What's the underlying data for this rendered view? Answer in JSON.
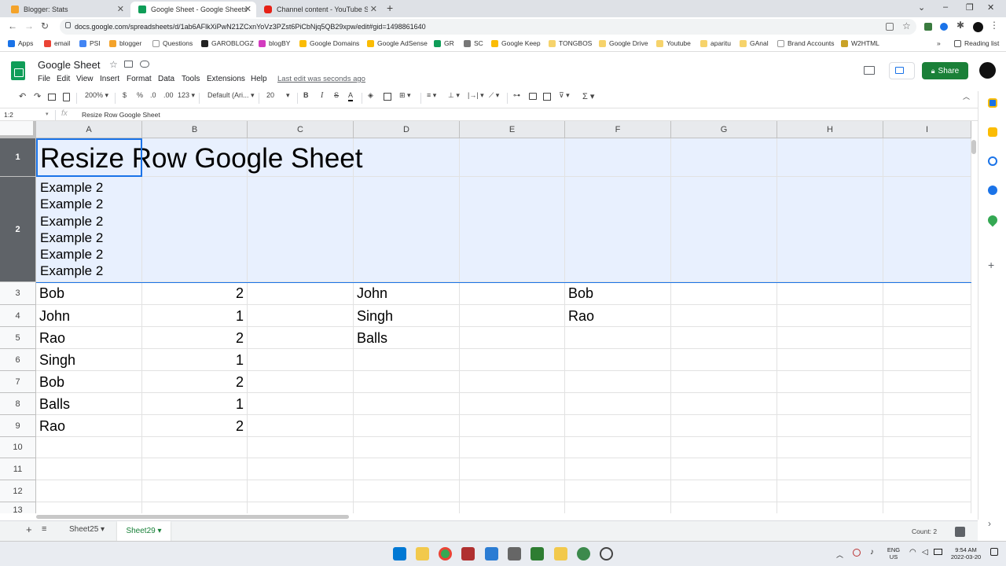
{
  "browser": {
    "tabs": [
      {
        "title": "Blogger: Stats",
        "fav_color": "#f4a32a"
      },
      {
        "title": "Google Sheet - Google Sheets",
        "fav_color": "#0f9d58"
      },
      {
        "title": "Channel content - YouTube Studio",
        "fav_color": "#e62117"
      }
    ],
    "url": "docs.google.com/spreadsheets/d/1ab6AFlkXiPwN21ZCxnYoVz3PZst6PiCbNjq5QB29xpw/edit#gid=1498861640",
    "bookmarks": [
      "Apps",
      "email",
      "PSI",
      "blogger",
      "Questions",
      "GAROBLOGZ",
      "blogBY",
      "Google Domains",
      "Google AdSense",
      "GR",
      "SC",
      "Google Keep",
      "TONGBOS",
      "Google Drive",
      "Youtube",
      "aparitu",
      "GAnal",
      "Brand Accounts",
      "W2HTML"
    ],
    "reading_list": "Reading list"
  },
  "sheets": {
    "doc_title": "Google Sheet",
    "menu": [
      "File",
      "Edit",
      "View",
      "Insert",
      "Format",
      "Data",
      "Tools",
      "Extensions",
      "Help"
    ],
    "last_edit": "Last edit was seconds ago",
    "share_label": "Share",
    "toolbar": {
      "zoom": "200%",
      "currency": "$",
      "percent": "%",
      "dec_dec": ".0",
      "dec_inc": ".00",
      "format": "123",
      "font": "Default (Ari...",
      "font_size": "20",
      "bold": "B",
      "italic": "I",
      "strike": "S",
      "text_color": "A"
    },
    "name_box": "1:2",
    "formula": "Resize Row Google Sheet"
  },
  "grid": {
    "columns": [
      "A",
      "B",
      "C",
      "D",
      "E",
      "F",
      "G",
      "H",
      "I"
    ],
    "rows": [
      "1",
      "2",
      "3",
      "4",
      "5",
      "6",
      "7",
      "8",
      "9",
      "10",
      "11",
      "12",
      "13"
    ],
    "title_cell": "Resize Row Google Sheet",
    "row2_lines": [
      "Example 2",
      "Example 2",
      "Example 2",
      "Example 2",
      "Example 2",
      "Example 2"
    ],
    "col_a": [
      "Bob",
      "John",
      "Rao",
      "Singh",
      "Bob",
      "Balls",
      "Rao"
    ],
    "col_b": [
      "2",
      "1",
      "2",
      "1",
      "2",
      "1",
      "2"
    ],
    "col_d": [
      "John",
      "Singh",
      "Balls"
    ],
    "col_f": [
      "Bob",
      "Rao"
    ]
  },
  "sheet_tabs": {
    "tabs": [
      "Sheet25",
      "Sheet29"
    ],
    "active": "Sheet29",
    "count": "Count: 2"
  },
  "taskbar": {
    "lang": "ENG",
    "region": "US",
    "time": "9:54 AM",
    "date": "2022-03-20"
  }
}
